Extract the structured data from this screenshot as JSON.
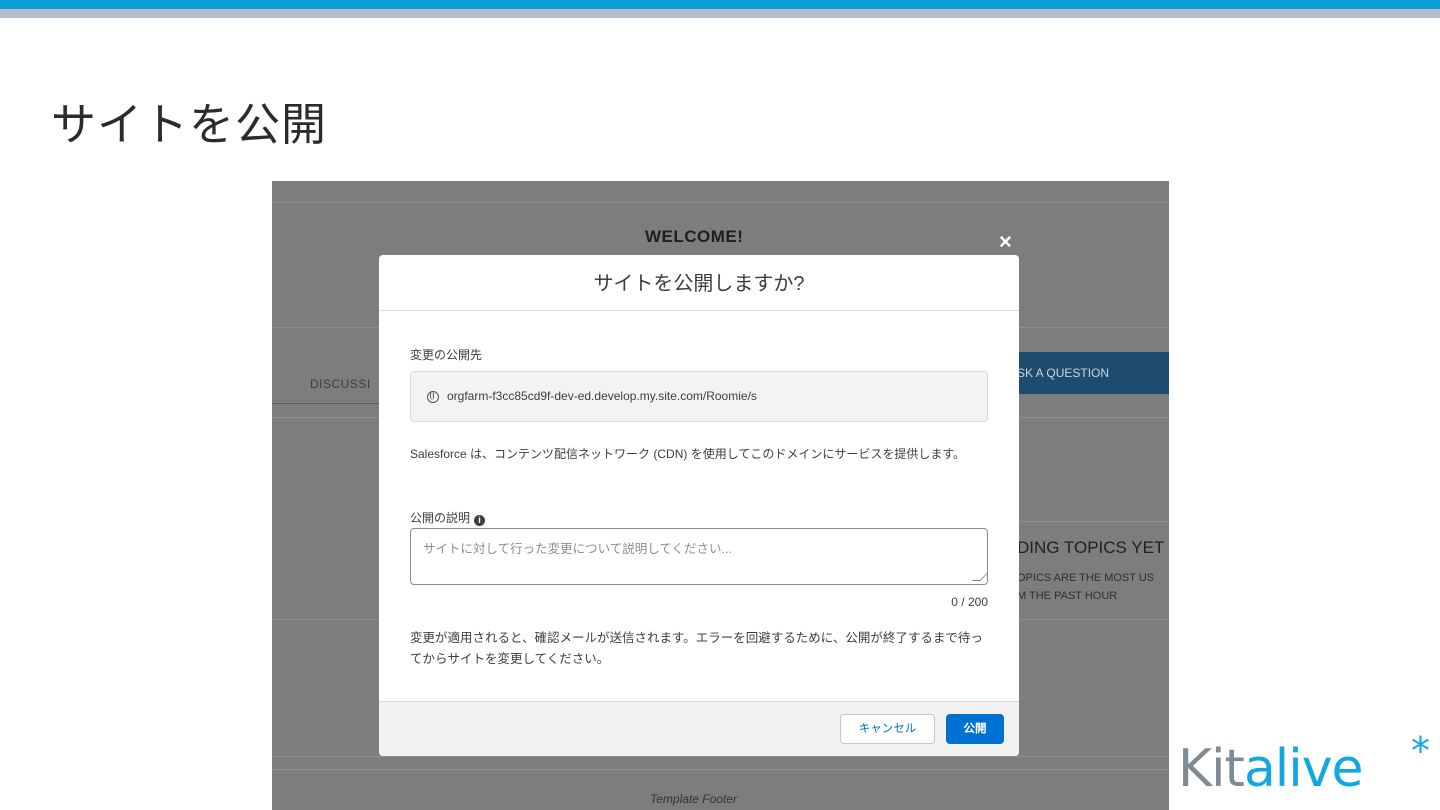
{
  "slide": {
    "title": "サイトを公開"
  },
  "background": {
    "welcome": "WELCOME!",
    "discussions_tab": "DISCUSSI",
    "ask_question": "SK A QUESTION",
    "topics_title": "DING TOPICS YET",
    "topics_line1": "OPICS ARE THE MOST US",
    "topics_line2": "M THE PAST HOUR",
    "footer": "Template Footer"
  },
  "modal": {
    "close_icon": "×",
    "title": "サイトを公開しますか?",
    "destination_label": "変更の公開先",
    "url": "orgfarm-f3cc85cd9f-dev-ed.develop.my.site.com/Roomie/s",
    "cdn_notice": "Salesforce は、コンテンツ配信ネットワーク (CDN) を使用してこのドメインにサービスを提供します。",
    "description_label": "公開の説明",
    "description_placeholder": "サイトに対して行った変更について説明してください...",
    "description_value": "",
    "char_counter": "0 / 200",
    "confirm_notice": "変更が適用されると、確認メールが送信されます。エラーを回避するために、公開が終了するまで待ってからサイトを変更してください。",
    "cancel_label": "キャンセル",
    "publish_label": "公開"
  },
  "logo": {
    "kit": "Kit",
    "alive": "alive",
    "star": "*"
  },
  "colors": {
    "accent": "#0070d2",
    "brand": "#13a6e0",
    "topbar": "#0b9ed7"
  }
}
